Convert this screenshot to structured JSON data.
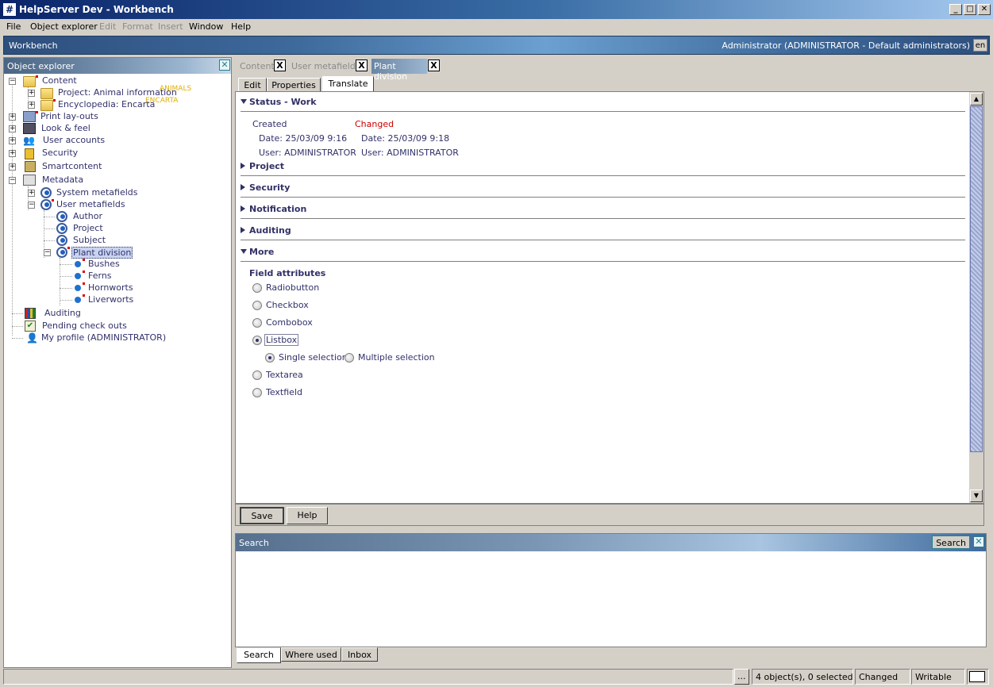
{
  "window": {
    "title": "HelpServer Dev - Workbench",
    "icon_char": "#"
  },
  "menu": {
    "file": "File",
    "object_explorer": "Object explorer",
    "edit": "Edit",
    "format": "Format",
    "insert": "Insert",
    "window": "Window",
    "help": "Help"
  },
  "workbench": {
    "title": "Workbench",
    "user": "Administrator (ADMINISTRATOR - Default administrators)",
    "lang": "en"
  },
  "explorer": {
    "title": "Object explorer",
    "content": "Content",
    "project_animal": "Project: Animal information",
    "project_animal_tag": "ANIMALS",
    "encyclopedia": "Encyclopedia: Encarta",
    "encyclopedia_tag": "ENCARTA",
    "print_layouts": "Print lay-outs",
    "look_feel": "Look & feel",
    "user_accounts": "User accounts",
    "security": "Security",
    "smartcontent": "Smartcontent",
    "metadata": "Metadata",
    "system_metafields": "System metafields",
    "user_metafields": "User metafields",
    "author": "Author",
    "project": "Project",
    "subject": "Subject",
    "plant_division": "Plant division",
    "bushes": "Bushes",
    "ferns": "Ferns",
    "hornworts": "Hornworts",
    "liverworts": "Liverworts",
    "auditing": "Auditing",
    "pending": "Pending check outs",
    "my_profile": "My profile (ADMINISTRATOR)"
  },
  "doctabs": {
    "content": "Content",
    "user_metafields": "User metafields",
    "plant_division": "Plant division",
    "close": "X"
  },
  "subtabs": {
    "edit": "Edit",
    "properties": "Properties",
    "translate": "Translate"
  },
  "status": {
    "header": "Status - Work",
    "created": "Created",
    "changed": "Changed",
    "created_date": "Date:  25/03/09 9:16",
    "changed_date": "Date:  25/03/09 9:18",
    "created_user": "User:  ADMINISTRATOR",
    "changed_user": "User:  ADMINISTRATOR"
  },
  "sections": {
    "project": "Project",
    "security": "Security",
    "notification": "Notification",
    "auditing": "Auditing",
    "more": "More"
  },
  "field_attributes": {
    "title": "Field attributes",
    "radiobutton": "Radiobutton",
    "checkbox": "Checkbox",
    "combobox": "Combobox",
    "listbox": "Listbox",
    "single": "Single selection",
    "multiple": "Multiple selection",
    "textarea": "Textarea",
    "textfield": "Textfield",
    "selected": "listbox",
    "selection_mode": "single"
  },
  "buttons": {
    "save": "Save",
    "help": "Help"
  },
  "search": {
    "title": "Search",
    "button": "Search"
  },
  "bottom_tabs": {
    "search": "Search",
    "where_used": "Where used",
    "inbox": "Inbox"
  },
  "statusbar": {
    "dots": "...",
    "count": "4 object(s), 0 selected",
    "state": "Changed",
    "mode": "Writable"
  },
  "colors": {
    "changed": "#cc0000",
    "tag": "#e0b000",
    "link": "#31316b"
  }
}
